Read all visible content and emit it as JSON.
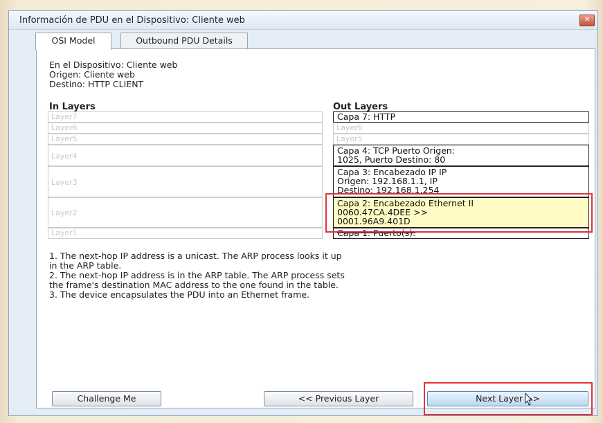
{
  "window": {
    "title": "Información de PDU en el Dispositivo: Cliente web",
    "close_icon": "close-icon"
  },
  "tabs": [
    {
      "label": "OSI Model",
      "active": true
    },
    {
      "label": "Outbound PDU Details",
      "active": false
    }
  ],
  "device_info": {
    "device": "En el Dispositivo: Cliente web",
    "origin": "Origen: Cliente web",
    "destination": "Destino: HTTP CLIENT"
  },
  "in_layers": {
    "header": "In Layers",
    "items": [
      "Layer7",
      "Layer6",
      "Layer5",
      "Layer4",
      "Layer3",
      "Layer2",
      "Layer1"
    ]
  },
  "out_layers": {
    "header": "Out Layers",
    "items": [
      {
        "lines": [
          "Capa 7: HTTP"
        ],
        "state": "active"
      },
      {
        "lines": [
          "Layer6"
        ],
        "state": "inactive"
      },
      {
        "lines": [
          "Layer5"
        ],
        "state": "inactive"
      },
      {
        "lines": [
          "Capa 4: TCP Puerto Origen:",
          "1025, Puerto Destino: 80"
        ],
        "state": "active"
      },
      {
        "lines": [
          "Capa 3: Encabezado IP IP",
          "Origen: 192.168.1.1, IP",
          "Destino: 192.168.1.254"
        ],
        "state": "active"
      },
      {
        "lines": [
          "Capa 2: Encabezado Ethernet II",
          "0060.47CA.4DEE >>",
          "0001.96A9.401D"
        ],
        "state": "highlighted"
      },
      {
        "lines": [
          "Capa 1: Puerto(s):"
        ],
        "state": "active"
      }
    ]
  },
  "description": [
    "1. The next-hop IP address is a unicast. The ARP process looks it up",
    "in the ARP table.",
    "2. The next-hop IP address is in the ARP table. The ARP process sets",
    "the frame's destination MAC address to the one found in the table.",
    "3. The device encapsulates the PDU into an Ethernet frame."
  ],
  "buttons": {
    "challenge": "Challenge Me",
    "previous": "<< Previous Layer",
    "next": "Next Layer >>"
  },
  "colors": {
    "highlight_fill": "#fffbc4",
    "annotation_red": "#e0333a"
  }
}
